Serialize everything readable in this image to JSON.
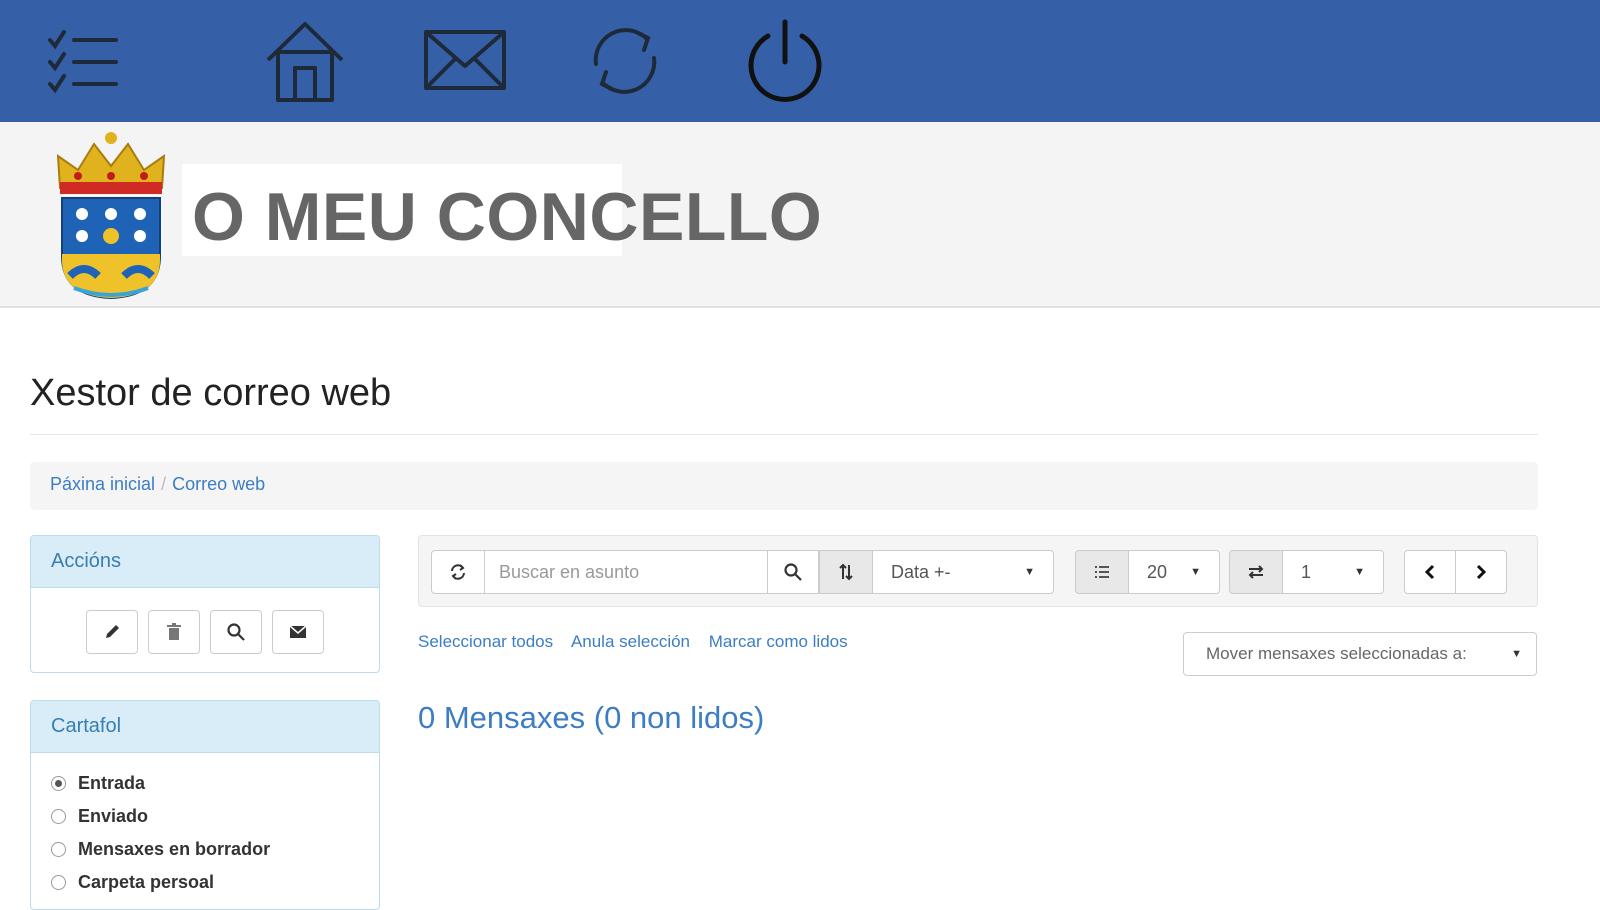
{
  "topbar": {
    "icons": [
      "checklist-menu-icon",
      "home-icon",
      "mail-icon",
      "refresh-icon",
      "power-icon"
    ],
    "background": "#3560a7"
  },
  "header": {
    "site_title": "O MEU CONCELLO"
  },
  "page": {
    "title": "Xestor de correo web"
  },
  "breadcrumb": {
    "items": [
      "Páxina inicial",
      "Correo web"
    ],
    "separator": "/"
  },
  "actions_panel": {
    "heading": "Accións",
    "buttons": [
      "pencil-icon",
      "trash-icon",
      "search-icon",
      "envelope-icon"
    ]
  },
  "folder_panel": {
    "heading": "Cartafol",
    "options": [
      {
        "label": "Entrada",
        "checked": true
      },
      {
        "label": "Enviado",
        "checked": false
      },
      {
        "label": "Mensaxes en borrador",
        "checked": false
      },
      {
        "label": "Carpeta persoal",
        "checked": false
      }
    ]
  },
  "toolbar": {
    "search_placeholder": "Buscar en asunto",
    "sort_value": "Data +-",
    "per_page_value": "20",
    "page_value": "1"
  },
  "links": {
    "select_all": "Seleccionar todos",
    "clear_selection": "Anula selección",
    "mark_read": "Marcar como lidos",
    "move_placeholder": "Mover mensaxes seleccionadas a:"
  },
  "summary": {
    "message_count": "0 Mensaxes (0 non lidos)"
  },
  "colors": {
    "accent": "#3c7dc4",
    "panel_head": "#d8edf8"
  }
}
